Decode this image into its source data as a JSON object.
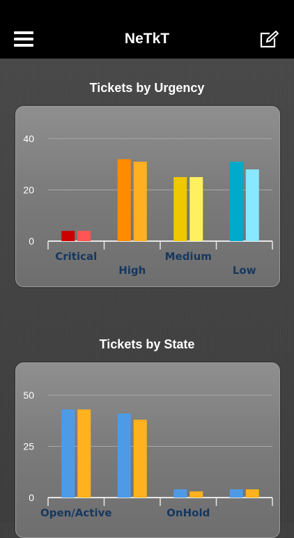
{
  "app": {
    "title": "NeTkT"
  },
  "icons": {
    "menu": "hamburger-menu-icon",
    "edit": "compose-edit-icon"
  },
  "colors": {
    "navbar": "#000000",
    "category_label": "#17375e",
    "tick_label": "#ffffff"
  },
  "chart_data": [
    {
      "type": "bar",
      "title": "Tickets by Urgency",
      "categories": [
        "Critical",
        "High",
        "Medium",
        "Low"
      ],
      "series": [
        {
          "values": [
            4,
            32,
            25,
            31
          ],
          "colors": [
            "#cc0000",
            "#ff8c00",
            "#f0c800",
            "#00aacc"
          ]
        },
        {
          "values": [
            4,
            31,
            25,
            28
          ],
          "colors": [
            "#ff5555",
            "#ffb020",
            "#fff060",
            "#88e8ff"
          ]
        }
      ],
      "ylim": [
        0,
        40
      ],
      "yticks": [
        "0",
        "20",
        "40"
      ],
      "grid": true
    },
    {
      "type": "bar",
      "title": "Tickets by State",
      "categories": [
        "Open/Active",
        "",
        "OnHold",
        ""
      ],
      "series": [
        {
          "values": [
            43,
            41,
            4,
            4
          ],
          "colors": [
            "#4d9be6",
            "#4d9be6",
            "#4d9be6",
            "#4d9be6"
          ]
        },
        {
          "values": [
            43,
            38,
            3,
            4
          ],
          "colors": [
            "#ffb21e",
            "#ffb21e",
            "#ffb21e",
            "#ffb21e"
          ]
        }
      ],
      "ylim": [
        0,
        50
      ],
      "yticks": [
        "0",
        "25",
        "50"
      ],
      "grid": true
    }
  ]
}
